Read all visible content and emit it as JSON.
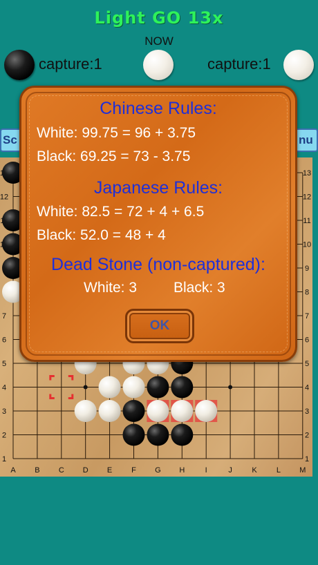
{
  "header": {
    "title": "Light GO 13x",
    "turn_label": "NOW"
  },
  "players": {
    "black": {
      "capture_label": "capture:1"
    },
    "white": {
      "capture_label": "capture:1"
    }
  },
  "buttons": {
    "left_partial": "Sc",
    "right_partial": "nu"
  },
  "board": {
    "columns": [
      "A",
      "B",
      "C",
      "D",
      "E",
      "F",
      "G",
      "H",
      "I",
      "J",
      "K",
      "L",
      "M"
    ],
    "rows": [
      "13",
      "12",
      "11",
      "10",
      "9",
      "8",
      "7",
      "6",
      "5",
      "4",
      "3",
      "2",
      "1"
    ]
  },
  "dialog": {
    "chinese_title": "Chinese Rules:",
    "chinese_white": "White: 99.75 = 96 + 3.75",
    "chinese_black": "Black: 69.25 = 73 - 3.75",
    "japanese_title": "Japanese Rules:",
    "japanese_white": "White: 82.5 = 72 + 4 + 6.5",
    "japanese_black": "Black: 52.0 = 48 + 4",
    "dead_title": "Dead Stone (non-captured):",
    "dead_white": "White: 3",
    "dead_black": "Black: 3",
    "ok_label": "OK"
  },
  "colors": {
    "title": "#2ef25a",
    "dialog_heading": "#1f2fd8",
    "background": "#0e8a83",
    "marker": "#e53030"
  }
}
